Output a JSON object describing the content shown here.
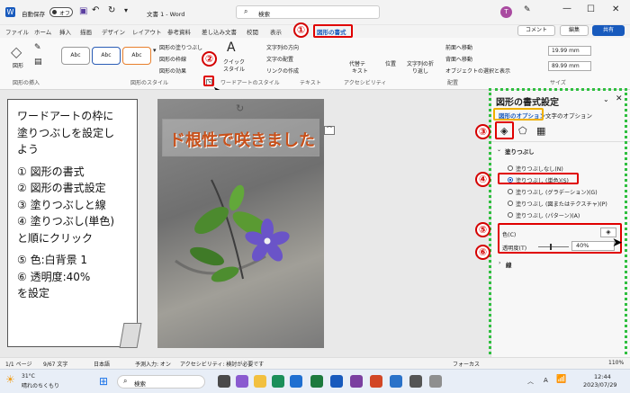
{
  "titlebar": {
    "autosave": "自動保存",
    "toggle": "オフ",
    "doc_title": "文書 1 - Word",
    "search": "検索",
    "user_initial": "T"
  },
  "tabs": [
    "ファイル",
    "ホーム",
    "挿入",
    "描画",
    "デザイン",
    "レイアウト",
    "参考資料",
    "差し込み文書",
    "校閲",
    "表示",
    "図形の書式"
  ],
  "ribbon": {
    "comment_btn": "コメント",
    "edit_btn": "編集",
    "share_btn": "共有",
    "shape_buttons": [
      "図形の塗りつぶし",
      "図形の枠線",
      "図形の効果"
    ],
    "style_abc": [
      "Abc",
      "Abc",
      "Abc"
    ],
    "wordart_buttons": [
      "クイック",
      "スタイル"
    ],
    "text_buttons": [
      "文字列の方向",
      "文字の配置",
      "リンクの作成"
    ],
    "alt_text": [
      "代替テ",
      "キスト"
    ],
    "arrange_left": [
      "位置",
      "文字列の折",
      "り返し"
    ],
    "arrange_right": [
      "前面へ移動",
      "背面へ移動",
      "オブジェクトの選択と表示"
    ],
    "height": "19.99 mm",
    "width": "89.99 mm",
    "groups": {
      "insert": "図形の挿入",
      "styles": "図形のスタイル",
      "wordart": "ワードアートのスタイル",
      "text": "テキスト",
      "access": "アクセシビリティ",
      "arrange": "配置",
      "size": "サイズ"
    }
  },
  "note": {
    "lines": [
      "ワードアートの枠に",
      "塗りつぶしを設定し",
      "よう",
      "",
      "① 図形の書式",
      "② 図形の書式設定",
      "③ 塗りつぶしと線",
      "④ 塗りつぶし(単色)",
      "と順にクリック",
      "",
      "⑤ 色:白背景 1",
      "⑥ 透明度:40%",
      "を設定"
    ]
  },
  "wordart": {
    "text": "ド根性で咲きました"
  },
  "panel": {
    "title": "図形の書式設定",
    "tab_shape": "図形のオプション",
    "tab_text": "文字のオプション",
    "section_fill": "塗りつぶし",
    "options": [
      "塗りつぶしなし(N)",
      "塗りつぶし (単色)(S)",
      "塗りつぶし (グラデーション)(G)",
      "塗りつぶし (図またはテクスチャ)(P)",
      "塗りつぶし (パターン)(A)"
    ],
    "color_label": "色(C)",
    "transparency_label": "透明度(T)",
    "transparency_value": "40%",
    "section_line": "線"
  },
  "badges": [
    "①",
    "②",
    "③",
    "④",
    "⑤",
    "⑥"
  ],
  "status": {
    "page": "1/1 ページ",
    "words": "9/67 文字",
    "lang": "日本語",
    "predict": "予測入力: オン",
    "access": "アクセシビリティ: 検討が必要です",
    "focus": "フォーカス",
    "zoom": "110%"
  },
  "taskbar": {
    "temp": "31°C",
    "weather": "晴れのちくもり",
    "search": "検索",
    "time": "12:44",
    "date": "2023/07/29",
    "lang_a": "A"
  },
  "colors": {
    "accent": "#185abd",
    "red": "#e00000",
    "green": "#2fbf3f",
    "wordart": "#c8501a"
  }
}
